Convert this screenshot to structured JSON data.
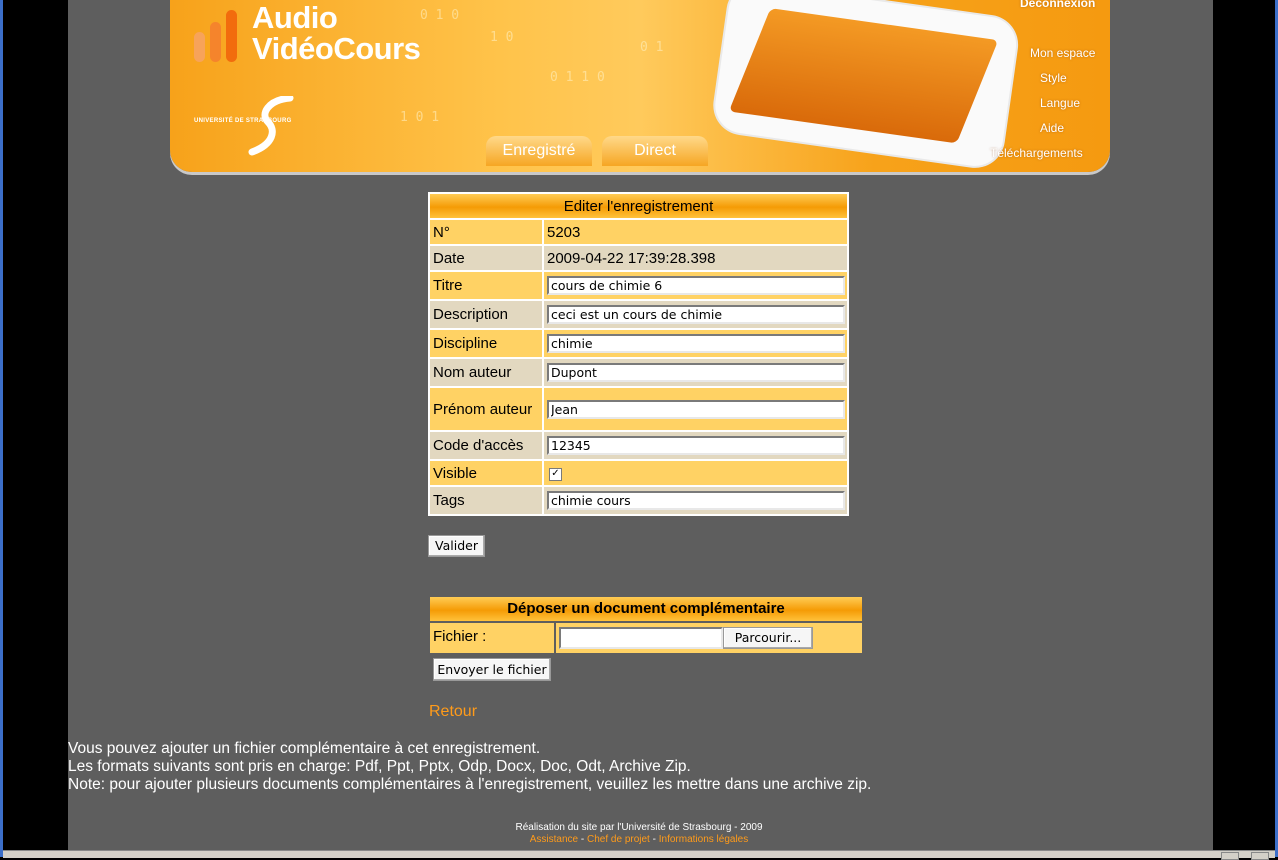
{
  "banner": {
    "logo_line1": "Audio",
    "logo_line2": "VidéoCours",
    "university": "UNIVERSITÉ DE STRASBOURG",
    "tabs": [
      "Enregistré",
      "Direct"
    ],
    "menu": {
      "logout": "Déconnexion",
      "my_space": "Mon espace",
      "style": "Style",
      "language": "Langue",
      "help": "Aide",
      "downloads": "Téléchargements"
    }
  },
  "edit_form": {
    "title": "Editer l'enregistrement",
    "rows": [
      {
        "label": "N°",
        "value": "5203"
      },
      {
        "label": "Date",
        "value": "2009-04-22 17:39:28.398"
      },
      {
        "label": "Titre",
        "value": "cours de chimie 6"
      },
      {
        "label": "Description",
        "value": "ceci est un cours de chimie"
      },
      {
        "label": "Discipline",
        "value": "chimie"
      },
      {
        "label": "Nom auteur",
        "value": "Dupont"
      },
      {
        "label": "Prénom auteur",
        "value": "Jean"
      },
      {
        "label": "Code d'accès",
        "value": "12345"
      },
      {
        "label": "Visible",
        "checked": "✓"
      },
      {
        "label": "Tags",
        "value": "chimie cours"
      }
    ],
    "submit_label": "Valider"
  },
  "upload": {
    "title": "Déposer un document complémentaire",
    "file_label": "Fichier :",
    "file_value": "",
    "browse_label": "Parcourir...",
    "send_label": "Envoyer le fichier"
  },
  "back_link": "Retour",
  "info_lines": [
    "Vous pouvez ajouter un fichier complémentaire à cet enregistrement.",
    "Les formats suivants sont pris en charge: Pdf, Ppt, Pptx, Odp, Docx, Doc, Odt, Archive Zip.",
    "Note: pour ajouter plusieurs documents complémentaires à l'enregistrement, veuillez les mettre dans une archive zip."
  ],
  "footer": {
    "credit": "Réalisation du site par l'Université de Strasbourg - 2009",
    "links": [
      "Assistance",
      "Chef de projet",
      "Informations légales"
    ],
    "separator": " - "
  },
  "colors": {
    "accent": "#f59b05",
    "row_yellow": "#ffd264",
    "row_beige": "#e2d8c0",
    "link": "#ff9b1a",
    "page_bg": "#5e5e5e"
  }
}
